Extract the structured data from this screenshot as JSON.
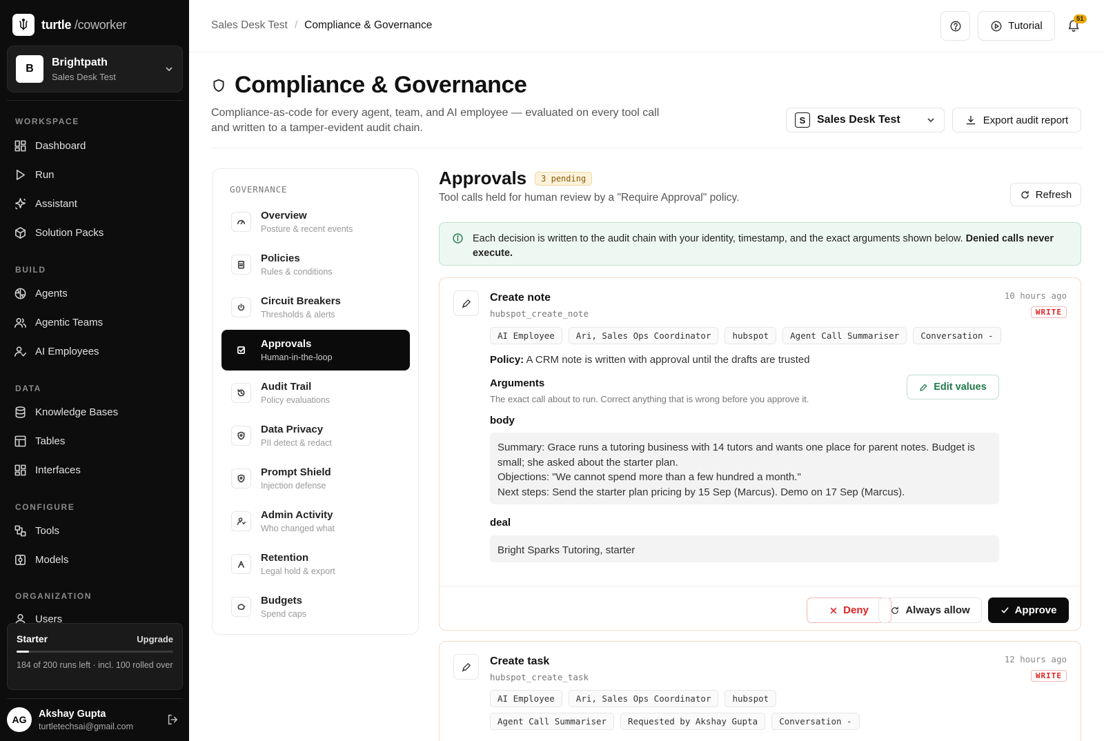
{
  "brand": {
    "name": "turtle",
    "sub": "/coworker"
  },
  "workspace": {
    "initial": "B",
    "name": "Brightpath",
    "sub": "Sales Desk Test"
  },
  "nav": {
    "workspace_label": "WORKSPACE",
    "workspace_items": [
      "Dashboard",
      "Run",
      "Assistant",
      "Solution Packs"
    ],
    "build_label": "BUILD",
    "build_items": [
      "Agents",
      "Agentic Teams",
      "AI Employees"
    ],
    "data_label": "DATA",
    "data_items": [
      "Knowledge Bases",
      "Tables",
      "Interfaces"
    ],
    "configure_label": "CONFIGURE",
    "configure_items": [
      "Tools",
      "Models"
    ],
    "organization_label": "ORGANIZATION",
    "organization_items": [
      "Users"
    ]
  },
  "plan": {
    "name": "Starter",
    "upgrade": "Upgrade",
    "text": "184 of 200 runs left · incl. 100 rolled over",
    "used_fraction": 0.08
  },
  "user": {
    "initials": "AG",
    "name": "Akshay Gupta",
    "email": "turtletechsai@gmail.com"
  },
  "header": {
    "crumb1": "Sales Desk Test",
    "sep": "/",
    "crumb2": "Compliance & Governance",
    "tutorial": "Tutorial",
    "notif_count": "51"
  },
  "page": {
    "title": "Compliance & Governance",
    "desc": "Compliance-as-code for every agent, team, and AI employee — evaluated on every tool call and written to a tamper-evident audit chain.",
    "ws_initial": "S",
    "ws_select": "Sales Desk Test",
    "export": "Export audit report"
  },
  "governance": {
    "title": "GOVERNANCE",
    "items": [
      {
        "label": "Overview",
        "sub": "Posture & recent events"
      },
      {
        "label": "Policies",
        "sub": "Rules & conditions"
      },
      {
        "label": "Circuit Breakers",
        "sub": "Thresholds & alerts"
      },
      {
        "label": "Approvals",
        "sub": "Human-in-the-loop"
      },
      {
        "label": "Audit Trail",
        "sub": "Policy evaluations"
      },
      {
        "label": "Data Privacy",
        "sub": "PII detect & redact"
      },
      {
        "label": "Prompt Shield",
        "sub": "Injection defense"
      },
      {
        "label": "Admin Activity",
        "sub": "Who changed what"
      },
      {
        "label": "Retention",
        "sub": "Legal hold & export"
      },
      {
        "label": "Budgets",
        "sub": "Spend caps"
      }
    ]
  },
  "approvals": {
    "title": "Approvals",
    "pending": "3 pending",
    "desc": "Tool calls held for human review by a \"Require Approval\" policy.",
    "refresh": "Refresh",
    "info_text": "Each decision is written to the audit chain with your identity, timestamp, and the exact arguments shown below. ",
    "info_bold": "Denied calls never execute.",
    "cards": [
      {
        "title": "Create note",
        "tool": "hubspot_create_note",
        "time": "10 hours ago",
        "badge": "WRITE",
        "tags": [
          "AI Employee",
          "Ari, Sales Ops Coordinator",
          "hubspot",
          "Agent Call Summariser",
          "Conversation -"
        ],
        "policy_label": "Policy:",
        "policy": "A CRM note is written with approval until the drafts are trusted",
        "args_title": "Arguments",
        "args_desc": "The exact call about to run. Correct anything that is wrong before you approve it.",
        "edit": "Edit values",
        "field1_label": "body",
        "field1_lines": [
          "Summary: Grace runs a tutoring business with 14 tutors and wants one place for parent notes. Budget is small; she asked about the starter plan.",
          "Objections: \"We cannot spend more than a few hundred a month.\"",
          "Next steps: Send the starter plan pricing by 15 Sep (Marcus). Demo on 17 Sep (Marcus)."
        ],
        "field2_label": "deal",
        "field2_value": "Bright Sparks Tutoring, starter",
        "deny": "Deny",
        "always": "Always allow",
        "approve": "Approve"
      },
      {
        "title": "Create task",
        "tool": "hubspot_create_task",
        "time": "12 hours ago",
        "badge": "WRITE",
        "tags": [
          "AI Employee",
          "Ari, Sales Ops Coordinator",
          "hubspot",
          "Agent Call Summariser",
          "Requested by Akshay Gupta",
          "Conversation -"
        ]
      }
    ]
  }
}
